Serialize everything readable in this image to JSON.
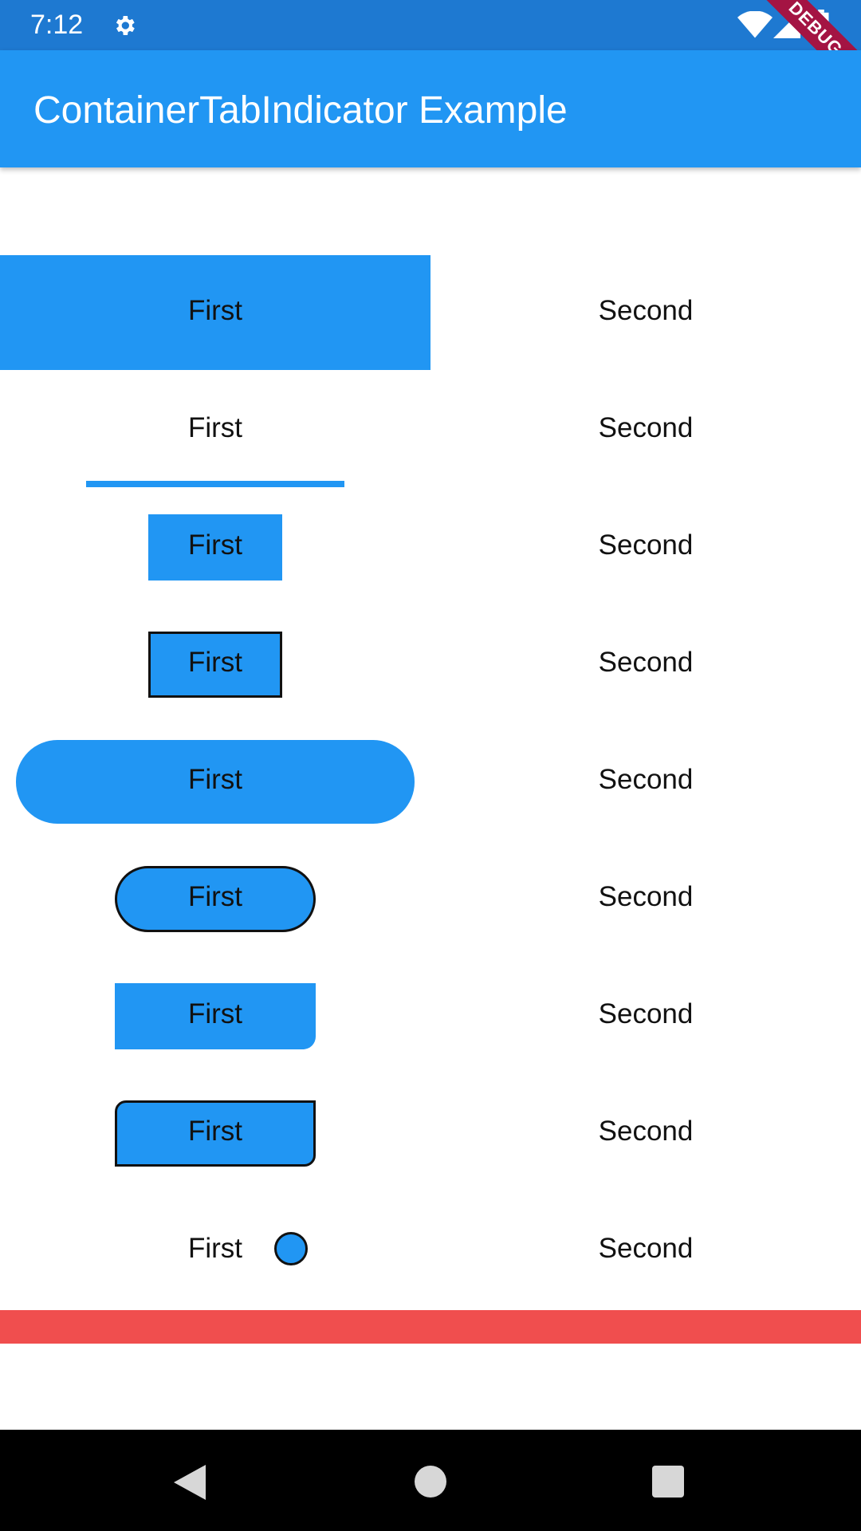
{
  "status_bar": {
    "time": "7:12",
    "icons": [
      "gear-icon",
      "wifi-icon",
      "signal-icon",
      "battery-icon"
    ],
    "debug_label": "DEBUG",
    "background": "#1e79d1"
  },
  "app_bar": {
    "title": "ContainerTabIndicator Example",
    "background": "#2196f3"
  },
  "tab_bars": [
    {
      "first": "First",
      "second": "Second",
      "indicator": "full-fill"
    },
    {
      "first": "First",
      "second": "Second",
      "indicator": "underline"
    },
    {
      "first": "First",
      "second": "Second",
      "indicator": "small-rect"
    },
    {
      "first": "First",
      "second": "Second",
      "indicator": "small-rect-border"
    },
    {
      "first": "First",
      "second": "Second",
      "indicator": "pill"
    },
    {
      "first": "First",
      "second": "Second",
      "indicator": "pill-border"
    },
    {
      "first": "First",
      "second": "Second",
      "indicator": "rounded-corner"
    },
    {
      "first": "First",
      "second": "Second",
      "indicator": "rounded-corner-border"
    },
    {
      "first": "First",
      "second": "Second",
      "indicator": "dot"
    }
  ],
  "colors": {
    "accent": "#2196f3",
    "border": "#111111",
    "divider": "#f04e4e"
  },
  "nav_bar": {
    "icons": [
      "back-icon",
      "home-icon",
      "recents-icon"
    ]
  }
}
